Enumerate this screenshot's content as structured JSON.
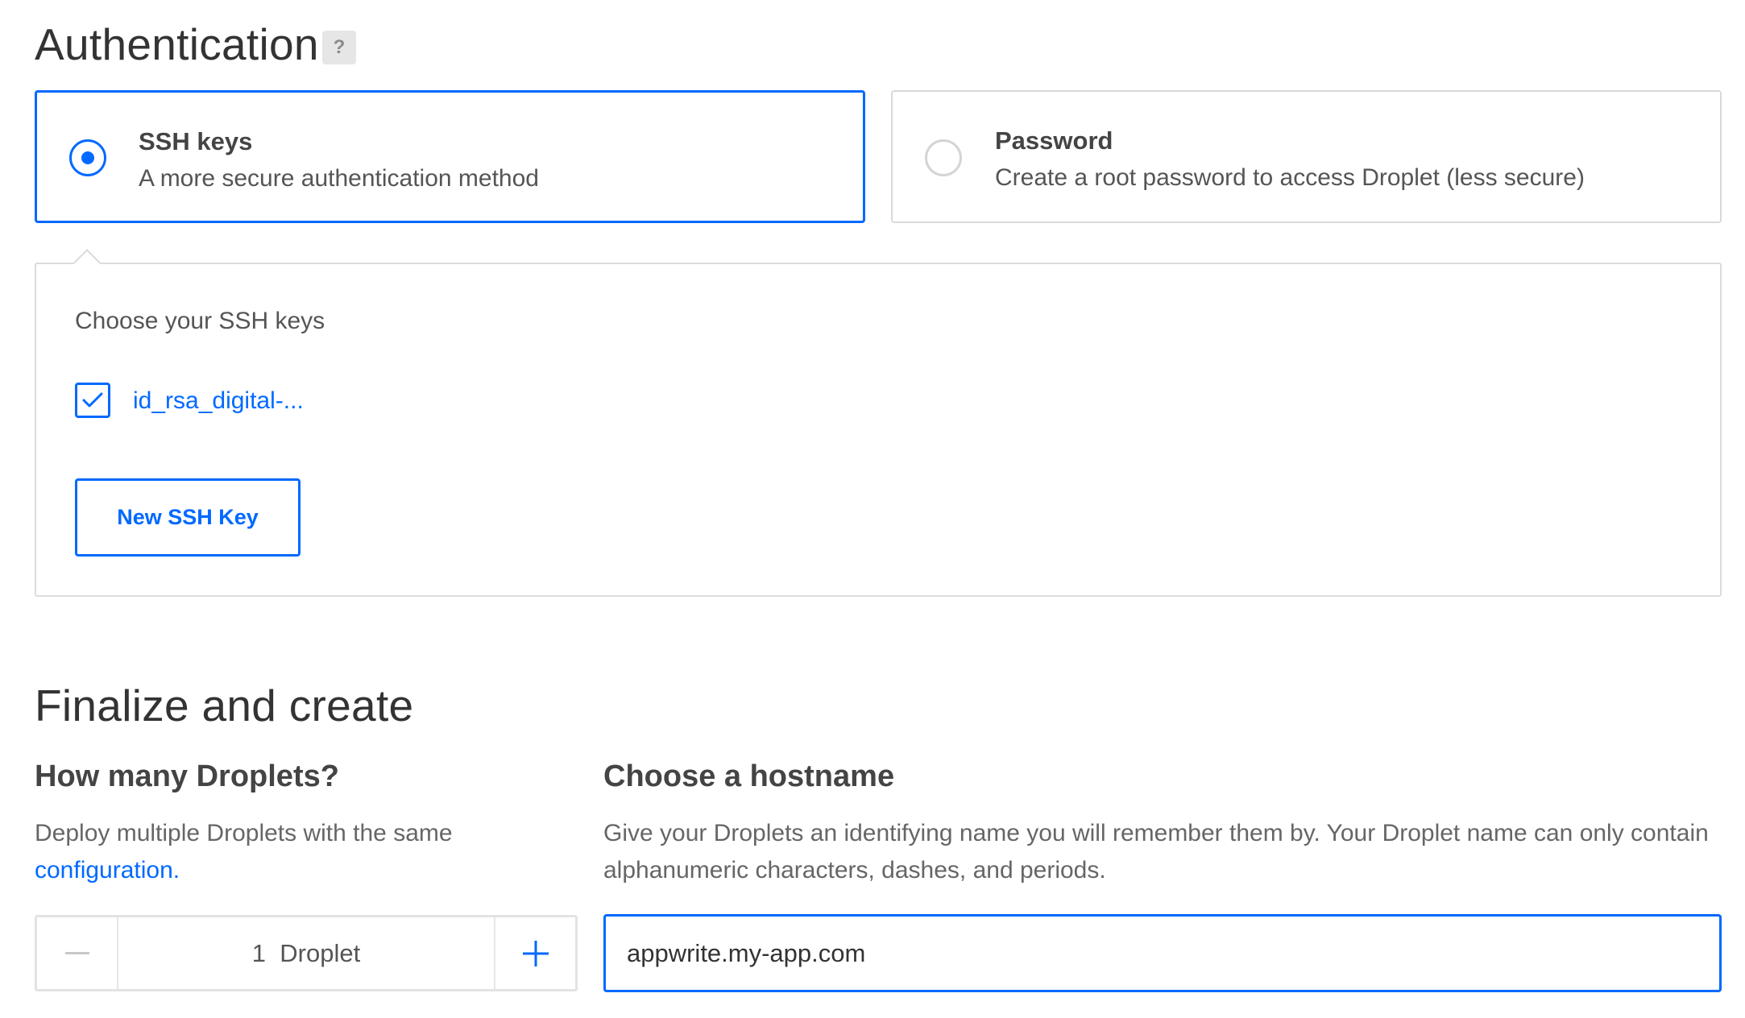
{
  "authentication": {
    "title": "Authentication",
    "help_label": "?",
    "options": [
      {
        "title": "SSH keys",
        "description": "A more secure authentication method",
        "selected": true
      },
      {
        "title": "Password",
        "description": "Create a root password to access Droplet (less secure)",
        "selected": false
      }
    ],
    "ssh_panel": {
      "label": "Choose your SSH keys",
      "keys": [
        {
          "name": "id_rsa_digital-...",
          "checked": true
        }
      ],
      "new_key_button": "New SSH Key"
    }
  },
  "finalize": {
    "title": "Finalize and create",
    "droplets": {
      "heading": "How many Droplets?",
      "description": "Deploy multiple Droplets with the same",
      "description_link": "configuration.",
      "count_label": "1  Droplet"
    },
    "hostname": {
      "heading": "Choose a hostname",
      "description": "Give your Droplets an identifying name you will remember them by. Your Droplet name can only contain alphanumeric characters, dashes, and periods.",
      "value": "appwrite.my-app.com"
    }
  },
  "colors": {
    "accent": "#0069ff",
    "border": "#d9d9d9",
    "text": "#444444"
  }
}
